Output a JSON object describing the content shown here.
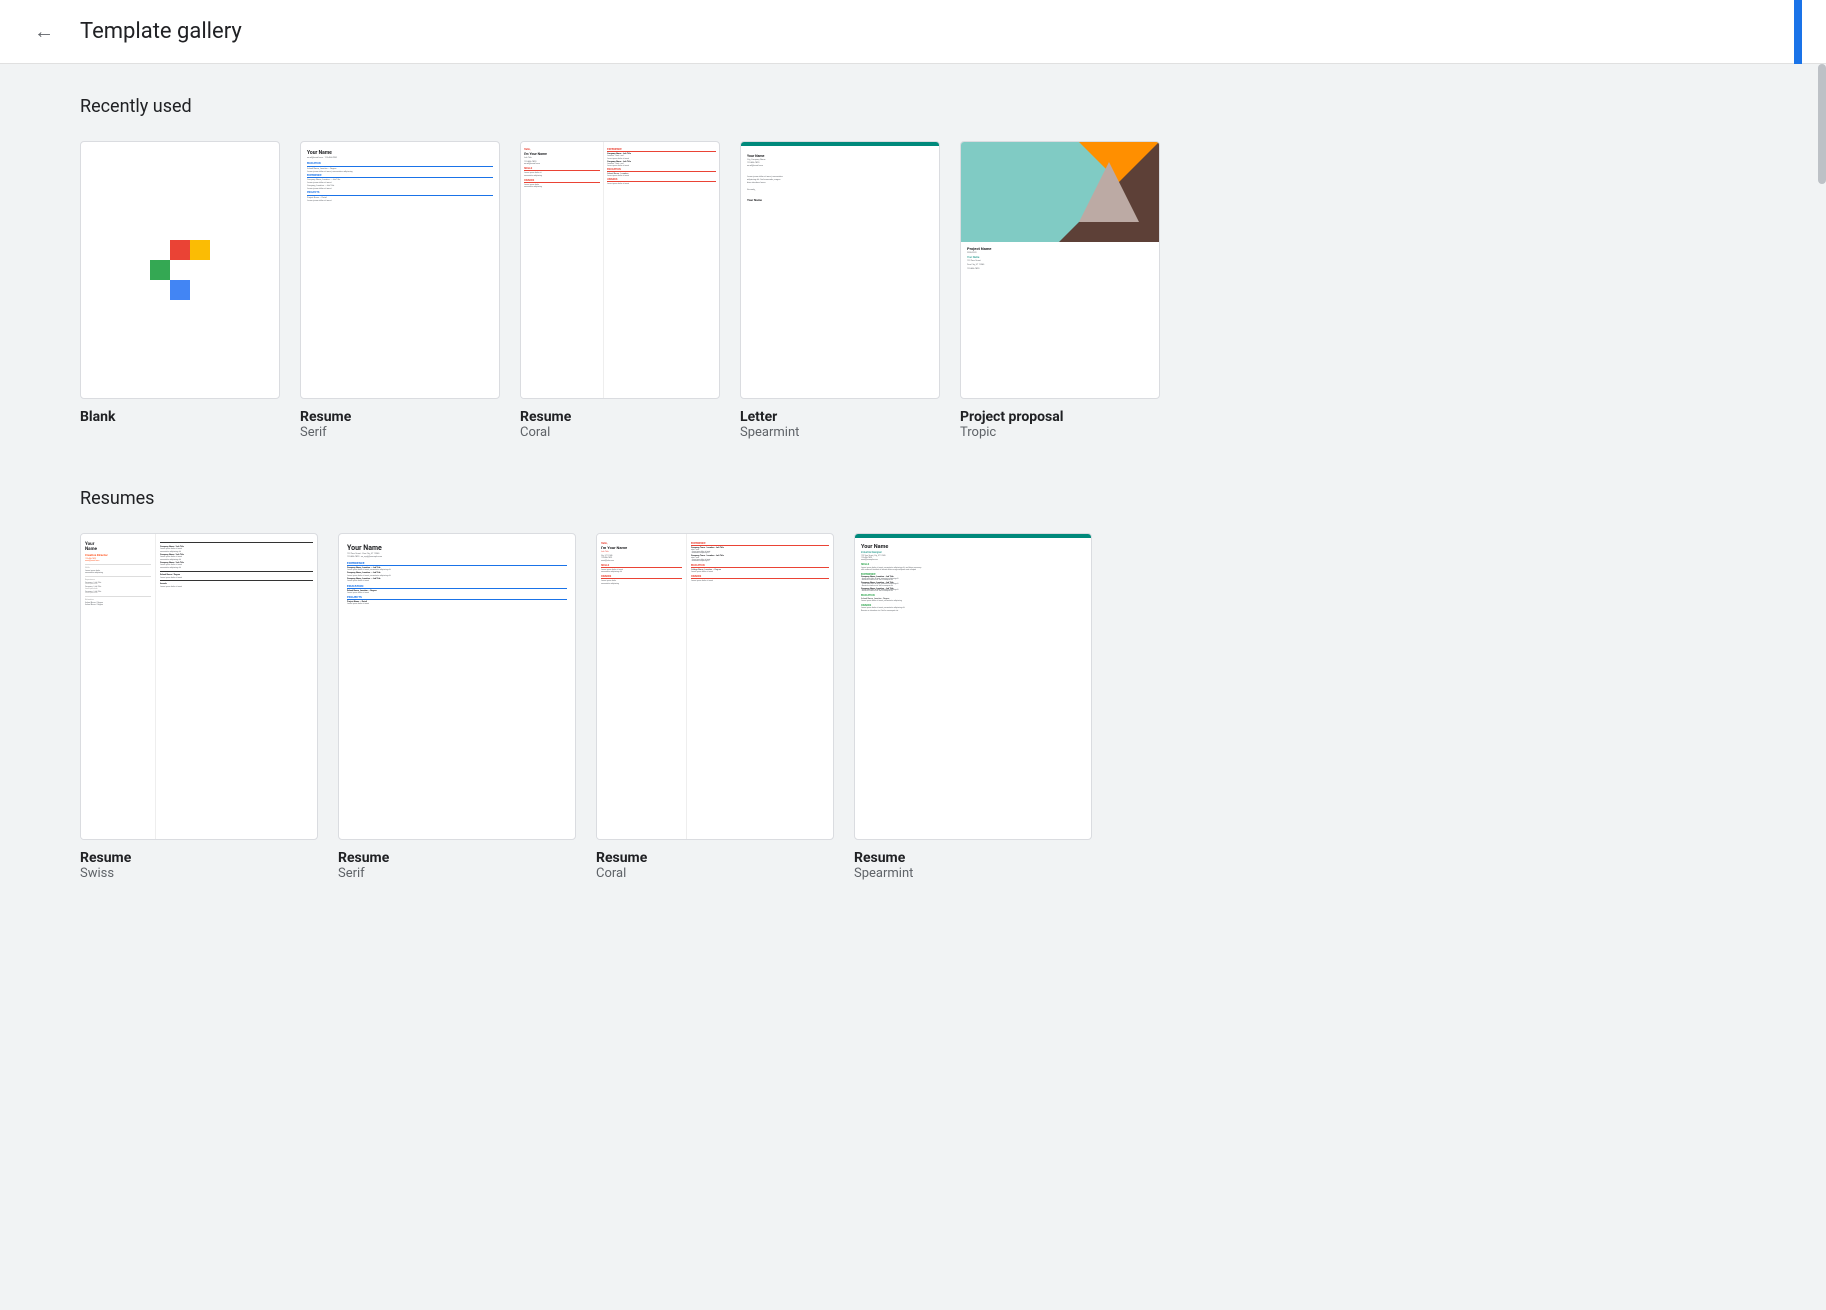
{
  "header": {
    "back_label": "←",
    "title": "Template gallery"
  },
  "recently_used": {
    "section_title": "Recently used",
    "items": [
      {
        "id": "blank",
        "name": "Blank",
        "subname": "",
        "type": "blank"
      },
      {
        "id": "resume-serif",
        "name": "Resume",
        "subname": "Serif",
        "type": "resume-serif"
      },
      {
        "id": "resume-coral",
        "name": "Resume",
        "subname": "Coral",
        "type": "resume-coral"
      },
      {
        "id": "letter-spearmint",
        "name": "Letter",
        "subname": "Spearmint",
        "type": "letter-spearmint"
      },
      {
        "id": "project-tropic",
        "name": "Project proposal",
        "subname": "Tropic",
        "type": "project-tropic"
      }
    ]
  },
  "resumes": {
    "section_title": "Resumes",
    "items": [
      {
        "id": "resume-swiss",
        "name": "Resume",
        "subname": "Swiss",
        "type": "resume-swiss"
      },
      {
        "id": "resume-serif2",
        "name": "Resume",
        "subname": "Serif",
        "type": "resume-serif2"
      },
      {
        "id": "resume-coral2",
        "name": "Resume",
        "subname": "Coral",
        "type": "resume-coral2"
      },
      {
        "id": "resume-spearmint",
        "name": "Resume",
        "subname": "Spearmint",
        "type": "resume-spearmint"
      }
    ]
  }
}
